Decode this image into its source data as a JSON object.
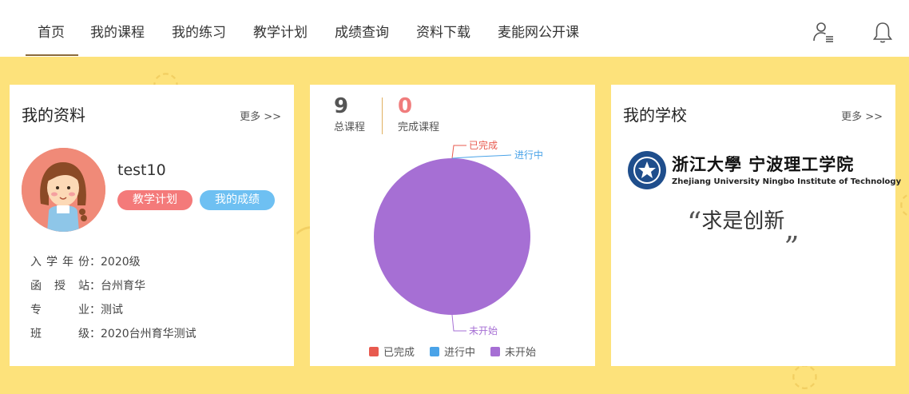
{
  "nav": {
    "items": [
      {
        "label": "首页",
        "active": true
      },
      {
        "label": "我的课程"
      },
      {
        "label": "我的练习"
      },
      {
        "label": "教学计划"
      },
      {
        "label": "成绩查询"
      },
      {
        "label": "资料下载"
      },
      {
        "label": "麦能网公开课"
      }
    ],
    "icons": [
      "user-list-icon",
      "bell-icon"
    ]
  },
  "profile": {
    "title": "我的资料",
    "more": "更多 >>",
    "username": "test10",
    "buttons": {
      "plan": "教学计划",
      "grades": "我的成绩"
    },
    "fields": [
      {
        "label": "入学年份",
        "value": "：2020级"
      },
      {
        "label": "函 授 站",
        "value": "：台州育华"
      },
      {
        "label": "专 业",
        "value": "：测试"
      },
      {
        "label": "班 级",
        "value": "：2020台州育华测试"
      }
    ]
  },
  "courses": {
    "total": "9",
    "total_label": "总课程",
    "completed": "0",
    "completed_label": "完成课程",
    "chart_data": {
      "type": "pie",
      "categories": [
        "已完成",
        "进行中",
        "未开始"
      ],
      "values": [
        0,
        0,
        9
      ],
      "colors": [
        "#e85a4f",
        "#4aa3e8",
        "#a66fd4"
      ],
      "legend_position": "bottom"
    }
  },
  "school": {
    "title": "我的学校",
    "more": "更多 >>",
    "name_cn": "浙江大學 宁波理工学院",
    "name_en": "Zhejiang University Ningbo Institute of Technology",
    "motto": "求是创新",
    "quote_open": "“",
    "quote_close": "„"
  },
  "colors": {
    "background_band": "#fde27b",
    "pill_plan": "#f47a7a",
    "pill_grades": "#6ec0f2",
    "total_number": "#555555",
    "completed_number": "#f07c7c",
    "emblem_blue": "#1f4e8c"
  }
}
